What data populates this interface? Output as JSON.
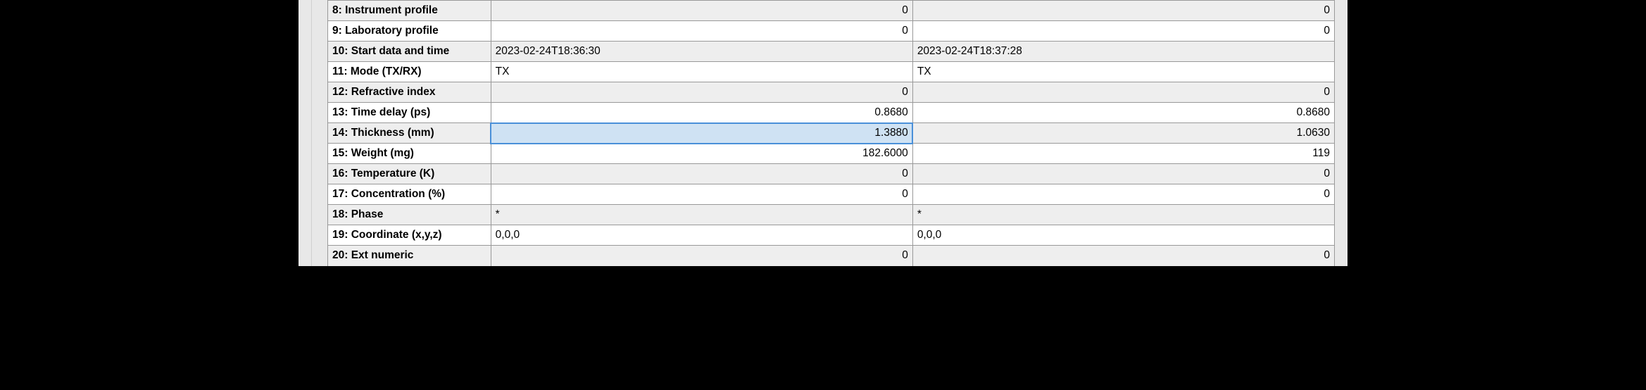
{
  "table": {
    "rows": [
      {
        "label": "8: Instrument profile",
        "align": "num",
        "shaded": true,
        "c1": "0",
        "c2": "0"
      },
      {
        "label": "9: Laboratory profile",
        "align": "num",
        "shaded": false,
        "c1": "0",
        "c2": "0"
      },
      {
        "label": "10: Start data and time",
        "align": "text",
        "shaded": true,
        "c1": "2023-02-24T18:36:30",
        "c2": "2023-02-24T18:37:28"
      },
      {
        "label": "11: Mode (TX/RX)",
        "align": "text",
        "shaded": false,
        "c1": "TX",
        "c2": "TX"
      },
      {
        "label": "12: Refractive index",
        "align": "num",
        "shaded": true,
        "c1": "0",
        "c2": "0"
      },
      {
        "label": "13: Time delay (ps)",
        "align": "num",
        "shaded": false,
        "c1": "0.8680",
        "c2": "0.8680"
      },
      {
        "label": "14: Thickness (mm)",
        "align": "num",
        "shaded": true,
        "c1": "1.3880",
        "c2": "1.0630",
        "selected": "c1"
      },
      {
        "label": "15: Weight (mg)",
        "align": "num",
        "shaded": false,
        "c1": "182.6000",
        "c2": "119"
      },
      {
        "label": "16: Temperature (K)",
        "align": "num",
        "shaded": true,
        "c1": "0",
        "c2": "0"
      },
      {
        "label": "17: Concentration (%)",
        "align": "num",
        "shaded": false,
        "c1": "0",
        "c2": "0"
      },
      {
        "label": "18: Phase",
        "align": "text",
        "shaded": true,
        "c1": "*",
        "c2": "*"
      },
      {
        "label": "19: Coordinate (x,y,z)",
        "align": "text",
        "shaded": false,
        "c1": "0,0,0",
        "c2": "0,0,0"
      },
      {
        "label": "20: Ext numeric",
        "align": "num",
        "shaded": true,
        "c1": "0",
        "c2": "0",
        "partial": true
      }
    ]
  }
}
